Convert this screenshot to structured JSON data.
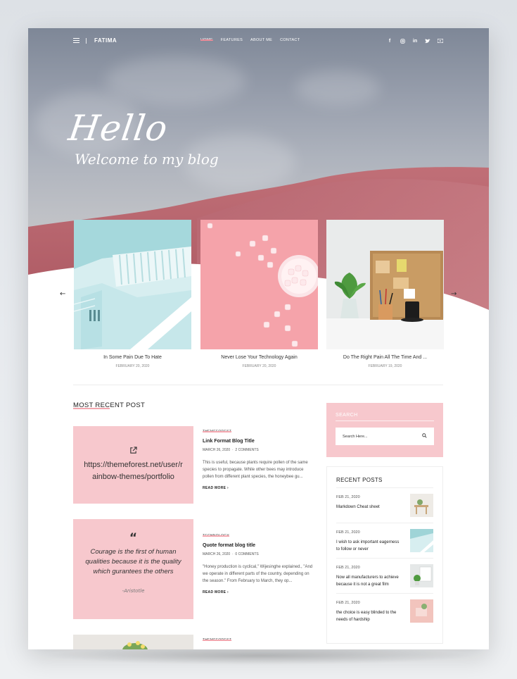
{
  "nav": {
    "brand": "FATIMA",
    "menu": [
      "HOME",
      "FEATURES",
      "ABOUT ME",
      "CONTACT"
    ],
    "social": [
      "facebook-icon",
      "instagram-icon",
      "linkedin-icon",
      "twitter-icon",
      "youtube-icon"
    ]
  },
  "hero": {
    "hello": "Hello",
    "welcome": "Welcome to my blog"
  },
  "slider": [
    {
      "title": "In Some Pain Due To Hate",
      "date": "FEBRUARY 20, 2020"
    },
    {
      "title": "Never Lose Your Technology Again",
      "date": "FEBRUARY 20, 2020"
    },
    {
      "title": "Do The Right Pain All The Time And ...",
      "date": "FEBRUARY 19, 2020"
    }
  ],
  "section_title": "MOST RECENT POST",
  "link_post": {
    "url": "https://themeforest.net/user/rainbow-themes/portfolio",
    "category": "THEMEFOREST",
    "title": "Link Format Blog Title",
    "date": "MARCH 26, 2020",
    "comments": "2 COMMENTS",
    "excerpt": "This is useful, because plants require pollen of the same species to propagate. While other bees may introduce pollen from different plant species, the honeybee gu...",
    "more": "READ MORE"
  },
  "quote_post": {
    "quote": "Courage is the first of human qualities because it is the quality which gurantees the others",
    "author": "-Aristotle",
    "category": "TECHNOLOGY",
    "title": "Quote format blog title",
    "date": "MARCH 26, 2020",
    "comments": "0 COMMENTS",
    "excerpt": "\"Honey production is cyclical,\" Wijesinghe explained., \"And we operate in different parts of the country, depending on the season.\" From February to March, they op...",
    "more": "READ MORE"
  },
  "third_post": {
    "category": "THEMEFOREST"
  },
  "search": {
    "label": "SEARCH",
    "placeholder": "Search Here..."
  },
  "recent_posts": {
    "heading": "RECENT POSTS",
    "items": [
      {
        "date": "FEB 21, 2020",
        "title": "Markdown Cheat sheet"
      },
      {
        "date": "FEB 21, 2020",
        "title": "I wish to ask important eagerness to follow or never"
      },
      {
        "date": "FEB 21, 2020",
        "title": "Now all manufacturers to achieve because it is not a great film"
      },
      {
        "date": "FEB 21, 2020",
        "title": "the choice is easy blinded to the needs of hardship"
      }
    ]
  },
  "colors": {
    "accent_pink": "#f7c8cd",
    "dune": "#b8606a"
  }
}
